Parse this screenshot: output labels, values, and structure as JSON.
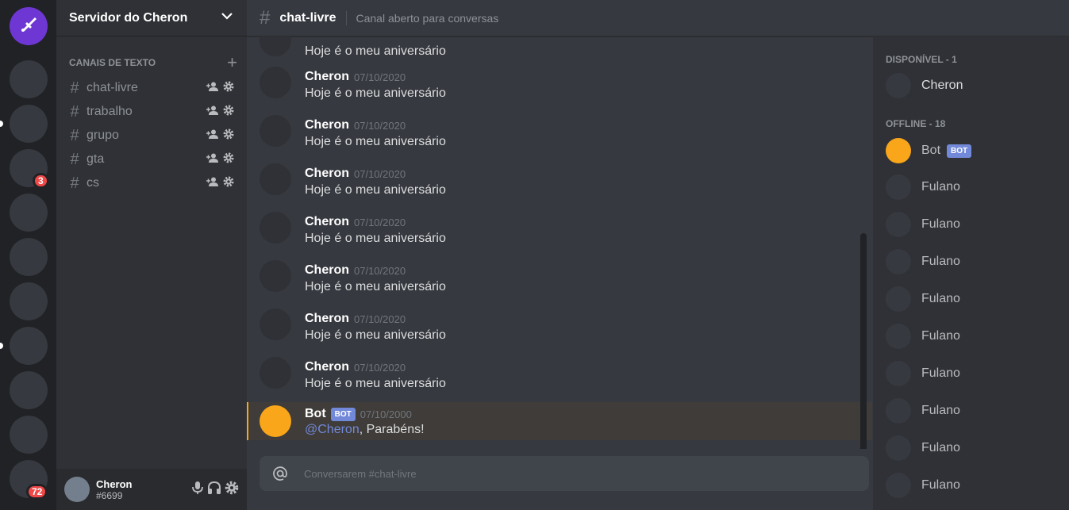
{
  "server_rail": {
    "home_icon": "sword-logo-icon",
    "colors": {
      "home": "#6e37d4",
      "badge": "#f04747"
    },
    "badges": [
      "3",
      "72"
    ]
  },
  "server": {
    "name": "Servidor do Cheron",
    "category": "CANAIS DE TEXTO",
    "channels": [
      "chat-livre",
      "trabalho",
      "grupo",
      "gta",
      "cs"
    ]
  },
  "user": {
    "name": "Cheron",
    "tag": "#6699"
  },
  "channel": {
    "title": "chat-livre",
    "topic": "Canal aberto para conversas"
  },
  "messages": [
    {
      "author": "",
      "timestamp": "",
      "text": "Hoje é o meu aniversário"
    },
    {
      "author": "Cheron",
      "timestamp": "07/10/2020",
      "text": "Hoje é o meu aniversário"
    },
    {
      "author": "Cheron",
      "timestamp": "07/10/2020",
      "text": "Hoje é o meu aniversário"
    },
    {
      "author": "Cheron",
      "timestamp": "07/10/2020",
      "text": "Hoje é o meu aniversário"
    },
    {
      "author": "Cheron",
      "timestamp": "07/10/2020",
      "text": "Hoje é o meu aniversário"
    },
    {
      "author": "Cheron",
      "timestamp": "07/10/2020",
      "text": "Hoje é o meu aniversário"
    },
    {
      "author": "Cheron",
      "timestamp": "07/10/2020",
      "text": "Hoje é o meu aniversário"
    },
    {
      "author": "Cheron",
      "timestamp": "07/10/2020",
      "text": "Hoje é o meu aniversário"
    }
  ],
  "bot_message": {
    "author": "Bot",
    "badge": "BOT",
    "timestamp": "07/10/2000",
    "mention": "@Cheron",
    "text": ", Parabéns!"
  },
  "composer": {
    "placeholder": "Conversarem #chat-livre"
  },
  "members": {
    "online_header": "DISPONÍVEL - 1",
    "online": [
      "Cheron"
    ],
    "offline_header": "OFFLINE - 18",
    "bot": {
      "name": "Bot",
      "badge": "BOT"
    },
    "offline": [
      "Fulano",
      "Fulano",
      "Fulano",
      "Fulano",
      "Fulano",
      "Fulano",
      "Fulano",
      "Fulano",
      "Fulano"
    ]
  },
  "colors": {
    "bot_avatar": "#faa61a",
    "bot_badge": "#7289da",
    "mention": "#7289da"
  }
}
